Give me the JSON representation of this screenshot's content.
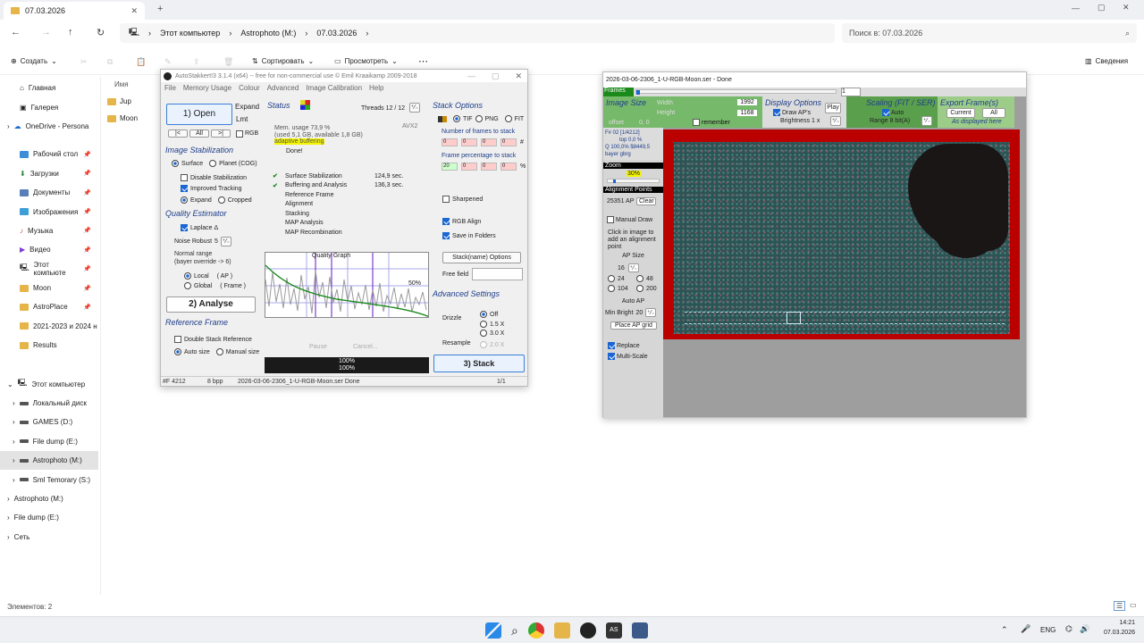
{
  "explorer": {
    "tab_title": "07.03.2026",
    "breadcrumb": [
      "Этот компьютер",
      "Astrophoto (M:)",
      "07.03.2026"
    ],
    "search_placeholder": "Поиск в: 07.03.2026",
    "commands": {
      "create": "Создать",
      "sort": "Сортировать",
      "view": "Просмотреть",
      "details": "Сведения"
    },
    "column_header": "Имя",
    "files": [
      "Jup",
      "Moon"
    ],
    "sidebar": {
      "top": [
        "Главная",
        "Галерея",
        "OneDrive - Persona"
      ],
      "quick": [
        "Рабочий стол",
        "Загрузки",
        "Документы",
        "Изображения",
        "Музыка",
        "Видео",
        "Этот компьюте",
        "Moon",
        "AstroPlace",
        "2021-2023 и 2024 н",
        "Results"
      ],
      "tree_root": "Этот компьютер",
      "drives": [
        "Локальный диск",
        "GAMES (D:)",
        "File dump (E:)",
        "Astrophoto (M:)",
        "Sml Temorary (S:)"
      ],
      "extra": [
        "Astrophoto (M:)",
        "File dump (E:)",
        "Сеть"
      ]
    },
    "status": "Элементов: 2"
  },
  "autostakkert": {
    "title": "AutoStakkert!3 3.1.4 (x64) -- free for non-commercial use © Emil Kraaikamp 2009-2018",
    "menu": [
      "File",
      "Memory Usage",
      "Colour",
      "Advanced",
      "Image Calibration",
      "Help"
    ],
    "open_btn": "1) Open",
    "expand": "Expand",
    "lmt": "Lmt",
    "nav": [
      "|<",
      "All",
      ">|"
    ],
    "rgb": "RGB",
    "img_stab_title": "Image Stabilization",
    "surface": "Surface",
    "planet": "Planet (COG)",
    "disable_stab": "Disable Stabilization",
    "improved_tracking": "Improved Tracking",
    "expand_opt": "Expand",
    "cropped": "Cropped",
    "quality_title": "Quality Estimator",
    "laplace": "Laplace Δ",
    "noise_robust": "Noise Robust",
    "noise_val": "5",
    "normal_range": "Normal range",
    "bayer_override": "(bayer override -> 6)",
    "local": "Local",
    "local_ap": "( AP )",
    "global": "Global",
    "global_frame": "( Frame )",
    "analyse_btn": "2) Analyse",
    "ref_frame_title": "Reference Frame",
    "double_stack": "Double Stack Reference",
    "auto_size": "Auto size",
    "manual_size": "Manual size",
    "status_title": "Status",
    "threads": "Threads 12 / 12",
    "avx": "AVX2",
    "mem_usage": "Mem. usage 73,9 %",
    "mem_detail": "(used 5,1 GB, available 1,8 GB)",
    "adaptive": "adaptive buffering",
    "done": "Done!",
    "steps": [
      {
        "label": "Surface Stabilization",
        "time": "124,9 sec.",
        "done": true
      },
      {
        "label": "Buffering and Analysis",
        "time": "136,3 sec.",
        "done": true
      },
      {
        "label": "Reference Frame",
        "time": "",
        "done": false
      },
      {
        "label": "Alignment",
        "time": "",
        "done": false
      },
      {
        "label": "Stacking",
        "time": "",
        "done": false
      },
      {
        "label": "MAP Analysis",
        "time": "",
        "done": false
      },
      {
        "label": "MAP Recombination",
        "time": "",
        "done": false
      }
    ],
    "quality_graph": "Quality Graph",
    "graph_pct": "50%",
    "pause": "Pause",
    "cancel": "Cancel...",
    "progress1": "100%",
    "progress2": "100%",
    "progress_value": 1.0,
    "stack_options_title": "Stack Options",
    "formats": [
      "TIF",
      "PNG",
      "FIT"
    ],
    "frames_to_stack": "Number of frames to stack",
    "frames_vals": [
      "0",
      "0",
      "0",
      "0"
    ],
    "frame_pct": "Frame percentage to stack",
    "pct_vals": [
      "20",
      "0",
      "0",
      "0"
    ],
    "sharpened": "Sharpened",
    "rgb_align": "RGB Align",
    "save_in_folders": "Save in Folders",
    "stack_name_opts": "Stack(name) Options",
    "free_field": "Free field",
    "adv_title": "Advanced Settings",
    "drizzle": "Drizzle",
    "drizzle_opts": [
      "Off",
      "1.5 X",
      "3.0 X"
    ],
    "resample": "Resample",
    "resample_val": "2.0 X",
    "stack_btn": "3) Stack",
    "status_frames": "#F 4212",
    "status_bpp": "8 bpp",
    "status_file": "2026-03-06-2306_1-U-RGB-Moon.ser  Done",
    "status_page": "1/1"
  },
  "viewer": {
    "title": "2026-03-06-2306_1-U-RGB-Moon.ser - Done",
    "frames_label": "Frames",
    "frame_num": "1",
    "image_size": "Image Size",
    "width_label": "Width",
    "height_label": "Height",
    "width_val": "1992",
    "height_val": "1168",
    "offset": "offset",
    "offset_val": "0, 0",
    "remember": "remember",
    "display_opts": "Display Options",
    "draw_aps": "Draw AP's",
    "brightness": "Brightness 1 x",
    "play": "Play",
    "scaling": "Scaling (FIT / SER)",
    "auto": "Auto",
    "range": "Range 8 bit(A)",
    "export": "Export Frame(s)",
    "current": "Current",
    "all": "All",
    "as_displayed": "As displayed here",
    "info1": "F# 02 [1/4212]",
    "info2": "top 0,0 %",
    "info3": "Q 100,0%  $8449,5",
    "info4": "bayer gbrg",
    "zoom_label": "Zoom",
    "zoom_val": "30%",
    "ap_label": "Alignment Points",
    "ap_count": "25351 AP",
    "clear": "Clear",
    "manual_draw": "Manual Draw",
    "click_hint": "Click in image to add an alignment point",
    "ap_size": "AP Size",
    "ap_size_val": "16",
    "sizes": [
      "24",
      "48",
      "104",
      "200"
    ],
    "auto_ap": "Auto AP",
    "min_bright": "Min Bright",
    "min_bright_val": "20",
    "place_grid": "Place AP grid",
    "replace": "Replace",
    "multiscale": "Multi-Scale"
  },
  "taskbar": {
    "lang": "ENG",
    "time": "14:21",
    "date": "07.03.2026"
  }
}
